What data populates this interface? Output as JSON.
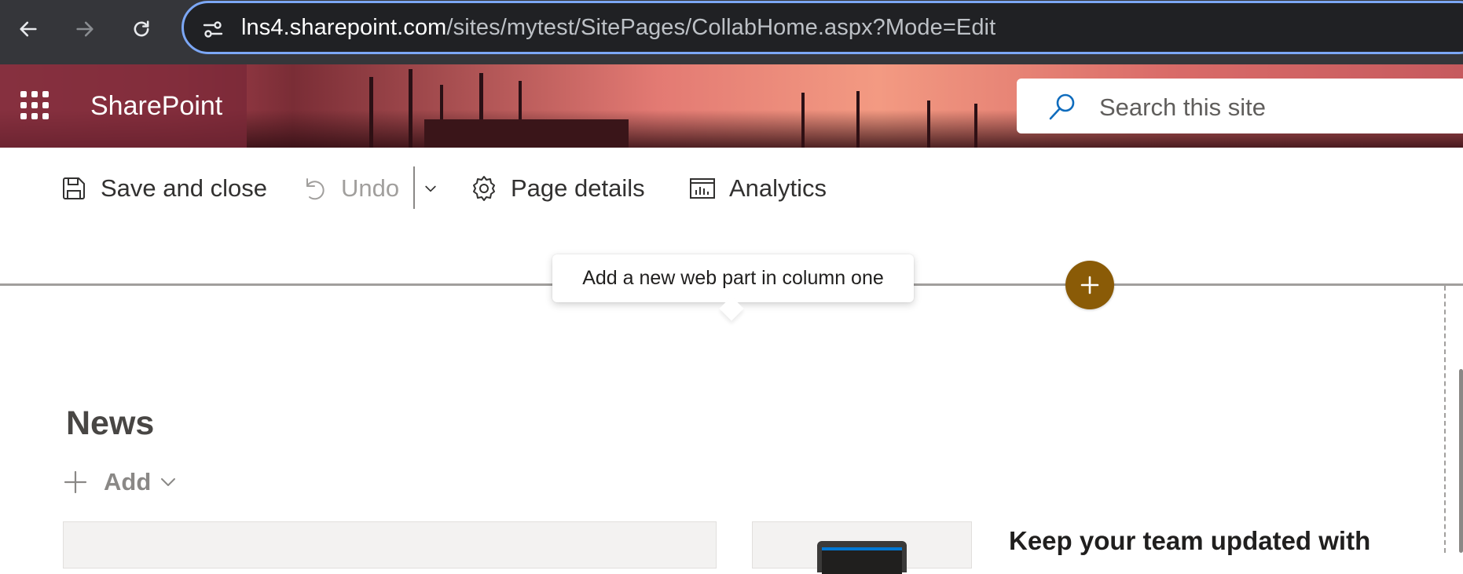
{
  "browser": {
    "url_host": "lns4.sharepoint.com",
    "url_path": "/sites/mytest/SitePages/CollabHome.aspx?Mode=Edit",
    "icons": [
      "back-icon",
      "forward-icon",
      "reload-icon",
      "site-info-icon"
    ]
  },
  "header": {
    "app_title": "SharePoint",
    "search_placeholder": "Search this site",
    "icons": [
      "app-launcher-icon",
      "search-icon"
    ]
  },
  "command_bar": {
    "save_label": "Save and close",
    "undo_label": "Undo",
    "page_details_label": "Page details",
    "analytics_label": "Analytics",
    "icons": [
      "save-icon",
      "undo-icon",
      "chevron-down-icon",
      "gear-icon",
      "analytics-icon"
    ]
  },
  "canvas": {
    "tooltip": "Add a new web part in column one",
    "add_button_icon": "plus-icon",
    "accent_color": "#8a5b07"
  },
  "news": {
    "title": "News",
    "add_label": "Add",
    "headline": "Keep your team updated with"
  }
}
